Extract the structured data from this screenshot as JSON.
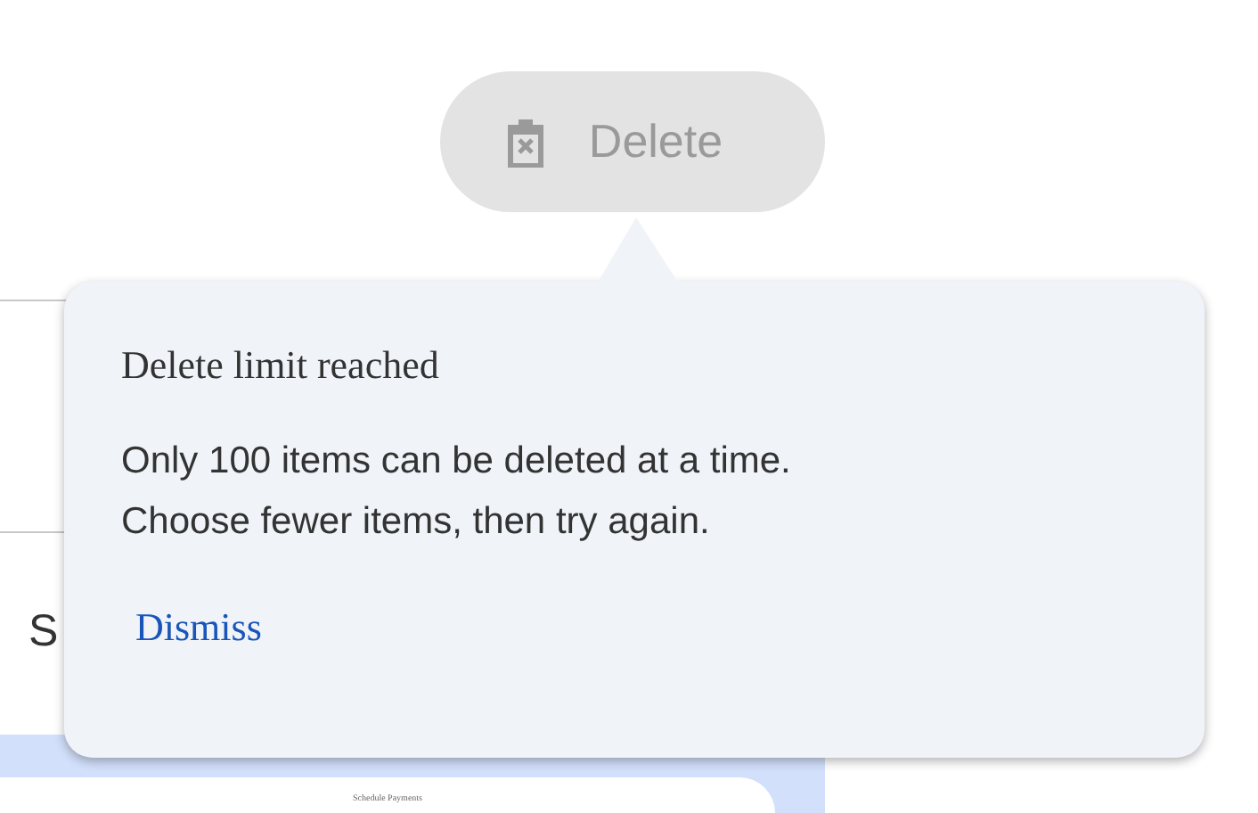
{
  "page": {
    "section_letter": "S",
    "card_heading": "Schedule Payments"
  },
  "delete_button": {
    "label": "Delete",
    "disabled": true
  },
  "tooltip": {
    "title": "Delete limit reached",
    "message": "Only 100 items can be deleted at a time. Choose fewer items, then try again.",
    "action": "Dismiss"
  }
}
